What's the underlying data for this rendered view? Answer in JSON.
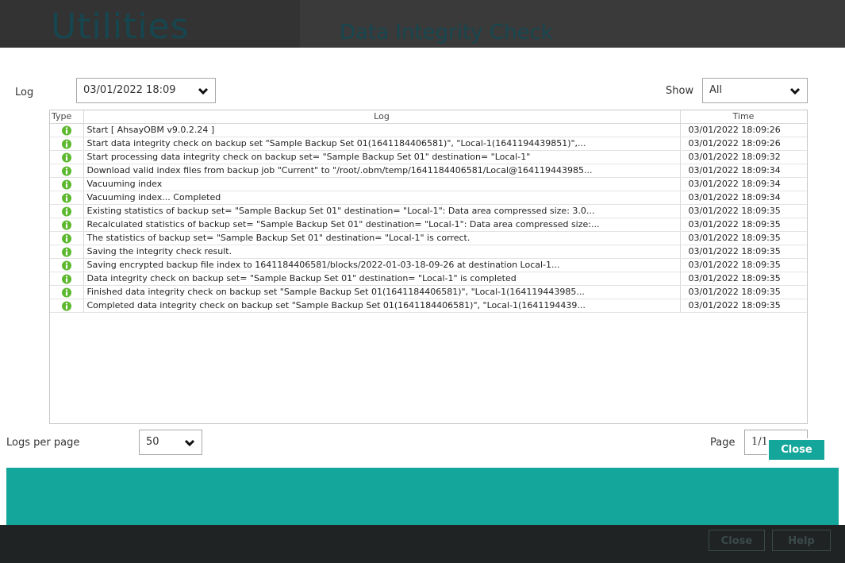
{
  "background": {
    "title": "Utilities",
    "subtitle": "Data Integrity Check",
    "close_label": "Close",
    "help_label": "Help"
  },
  "log_selector": {
    "label": "Log",
    "value": "03/01/2022 18:09"
  },
  "show_filter": {
    "label": "Show",
    "value": "All"
  },
  "table": {
    "columns": [
      "Type",
      "Log",
      "Time"
    ],
    "rows": [
      {
        "type_icon": "info-icon",
        "log": "Start [ AhsayOBM v9.0.2.24 ]",
        "time": "03/01/2022 18:09:26"
      },
      {
        "type_icon": "info-icon",
        "log": "Start data integrity check on backup set \"Sample Backup Set 01(1641184406581)\", \"Local-1(1641194439851)\",...",
        "time": "03/01/2022 18:09:26"
      },
      {
        "type_icon": "info-icon",
        "log": "Start processing data integrity check on backup set= \"Sample Backup Set 01\" destination= \"Local-1\"",
        "time": "03/01/2022 18:09:32"
      },
      {
        "type_icon": "info-icon",
        "log": "Download valid index files from backup job \"Current\" to \"/root/.obm/temp/1641184406581/Local@164119443985...",
        "time": "03/01/2022 18:09:34"
      },
      {
        "type_icon": "info-icon",
        "log": "Vacuuming index",
        "time": "03/01/2022 18:09:34"
      },
      {
        "type_icon": "info-icon",
        "log": "Vacuuming index... Completed",
        "time": "03/01/2022 18:09:34"
      },
      {
        "type_icon": "info-icon",
        "log": "Existing statistics of backup set= \"Sample Backup Set 01\" destination= \"Local-1\": Data area compressed size: 3.0...",
        "time": "03/01/2022 18:09:35"
      },
      {
        "type_icon": "info-icon",
        "log": "Recalculated statistics of backup set= \"Sample Backup Set 01\" destination= \"Local-1\": Data area compressed size:...",
        "time": "03/01/2022 18:09:35"
      },
      {
        "type_icon": "info-icon",
        "log": "The statistics of backup set= \"Sample Backup Set 01\" destination= \"Local-1\" is correct.",
        "time": "03/01/2022 18:09:35"
      },
      {
        "type_icon": "info-icon",
        "log": "Saving the integrity check result.",
        "time": "03/01/2022 18:09:35"
      },
      {
        "type_icon": "info-icon",
        "log": "Saving encrypted backup file index to 1641184406581/blocks/2022-01-03-18-09-26 at destination Local-1...",
        "time": "03/01/2022 18:09:35"
      },
      {
        "type_icon": "info-icon",
        "log": "Data integrity check on backup set= \"Sample Backup Set 01\" destination= \"Local-1\" is completed",
        "time": "03/01/2022 18:09:35"
      },
      {
        "type_icon": "info-icon",
        "log": "Finished data integrity check on backup set \"Sample Backup Set 01(1641184406581)\", \"Local-1(164119443985...",
        "time": "03/01/2022 18:09:35"
      },
      {
        "type_icon": "info-icon",
        "log": "Completed data integrity check on backup set \"Sample Backup Set 01(1641184406581)\", \"Local-1(1641194439...",
        "time": "03/01/2022 18:09:35"
      }
    ]
  },
  "logs_per_page": {
    "label": "Logs per page",
    "value": "50"
  },
  "pagination": {
    "label": "Page",
    "value": "1/1"
  },
  "footer": {
    "close_label": "Close"
  },
  "colors": {
    "accent": "#15a69b",
    "info_icon": "#5cb82e",
    "bg_dark": "#1f2323"
  }
}
